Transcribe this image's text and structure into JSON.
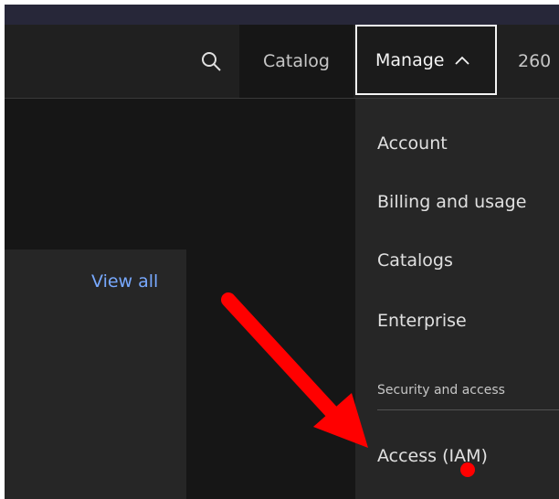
{
  "header": {
    "search_icon": "search-icon",
    "catalog_label": "Catalog",
    "manage_label": "Manage",
    "manage_chevron": "chevron-up-icon",
    "account_id_partial": "260"
  },
  "card": {
    "view_all_label": "View all"
  },
  "manage_menu": {
    "items": [
      {
        "label": "Account"
      },
      {
        "label": "Billing and usage"
      },
      {
        "label": "Catalogs"
      },
      {
        "label": "Enterprise"
      }
    ],
    "section_title": "Security and access",
    "section_items": [
      {
        "label": "Access (IAM)"
      }
    ]
  },
  "colors": {
    "background": "#161616",
    "menu_background": "#262626",
    "link": "#78a9ff",
    "annotation": "#ff0000"
  }
}
